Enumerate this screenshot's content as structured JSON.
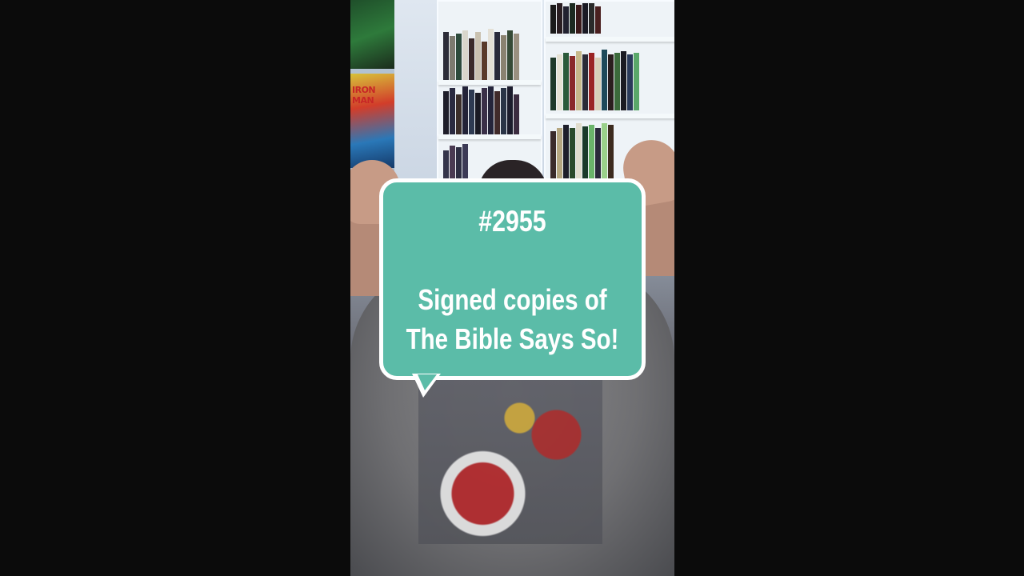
{
  "bubble": {
    "number": "#2955",
    "line1": "Signed copies of",
    "line2": "The Bible Says So!",
    "color": "#5bbca8",
    "border_color": "#ffffff"
  },
  "scene": {
    "poster_text": "IRON MAN"
  },
  "colors": {
    "background": "#0b0b0b"
  }
}
